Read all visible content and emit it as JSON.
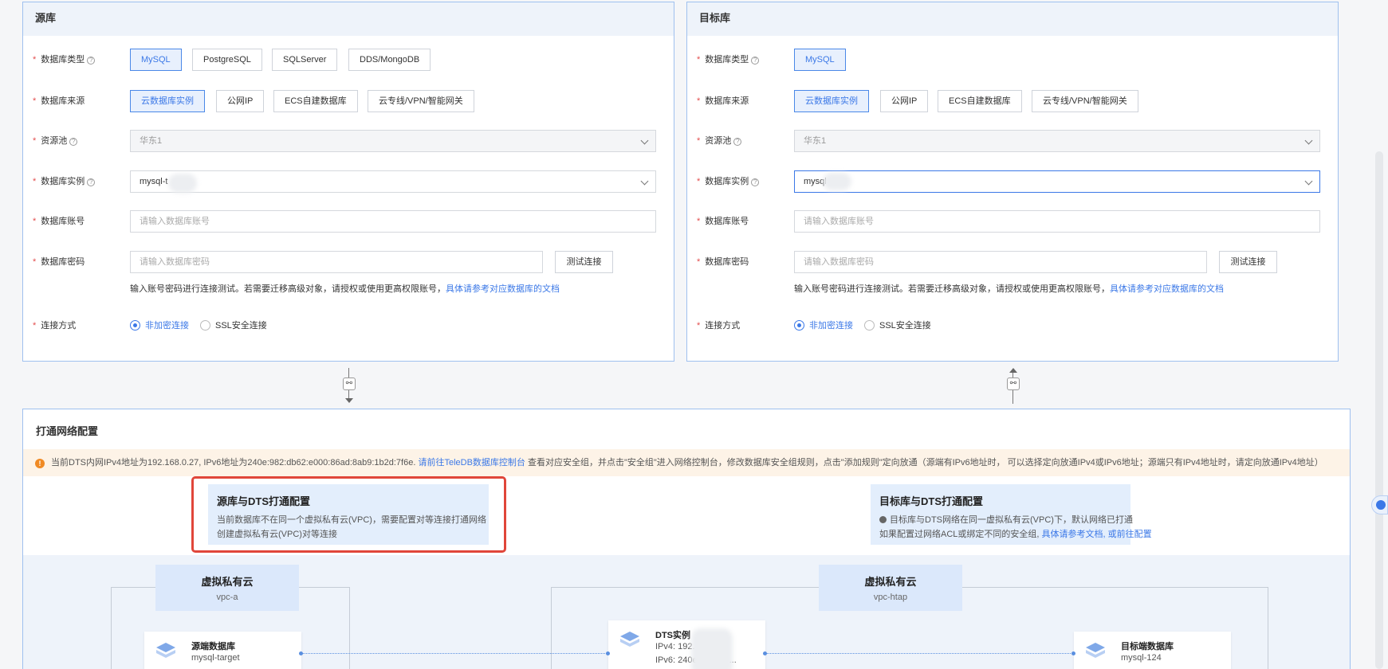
{
  "source": {
    "header": "源库",
    "db_type": {
      "label": "数据库类型",
      "options": [
        "MySQL",
        "PostgreSQL",
        "SQLServer",
        "DDS/MongoDB"
      ],
      "selected": "MySQL"
    },
    "db_source": {
      "label": "数据库来源",
      "options": [
        "云数据库实例",
        "公网IP",
        "ECS自建数据库",
        "云专线/VPN/智能网关"
      ],
      "selected": "云数据库实例"
    },
    "resource_pool": {
      "label": "资源池",
      "value": "华东1"
    },
    "instance": {
      "label": "数据库实例",
      "value": "mysql-t"
    },
    "account": {
      "label": "数据库账号",
      "placeholder": "请输入数据库账号"
    },
    "password": {
      "label": "数据库密码",
      "placeholder": "请输入数据库密码",
      "test_button": "测试连接"
    },
    "hint": {
      "text": "输入账号密码进行连接测试。若需要迁移高级对象，请授权或使用更高权限账号，",
      "link": "具体请参考对应数据库的文档"
    },
    "connection": {
      "label": "连接方式",
      "options": [
        "非加密连接",
        "SSL安全连接"
      ],
      "selected": "非加密连接"
    }
  },
  "target": {
    "header": "目标库",
    "db_type": {
      "label": "数据库类型",
      "options": [
        "MySQL"
      ],
      "selected": "MySQL"
    },
    "db_source": {
      "label": "数据库来源",
      "options": [
        "云数据库实例",
        "公网IP",
        "ECS自建数据库",
        "云专线/VPN/智能网关"
      ],
      "selected": "云数据库实例"
    },
    "resource_pool": {
      "label": "资源池",
      "value": "华东1"
    },
    "instance": {
      "label": "数据库实例",
      "value": "mysql"
    },
    "account": {
      "label": "数据库账号",
      "placeholder": "请输入数据库账号"
    },
    "password": {
      "label": "数据库密码",
      "placeholder": "请输入数据库密码",
      "test_button": "测试连接"
    },
    "hint": {
      "text": "输入账号密码进行连接测试。若需要迁移高级对象，请授权或使用更高权限账号，",
      "link": "具体请参考对应数据库的文档"
    },
    "connection": {
      "label": "连接方式",
      "options": [
        "非加密连接",
        "SSL安全连接"
      ],
      "selected": "非加密连接"
    }
  },
  "network": {
    "title": "打通网络配置",
    "notice": {
      "prefix": "当前DTS内网IPv4地址为192.168.0.27, IPv6地址为240e:982:db62:e000:86ad:8ab9:1b2d:7f6e.",
      "link": "请前往TeleDB数据库控制台",
      "suffix": "查看对应安全组，并点击\"安全组\"进入网络控制台，修改数据库安全组规则，点击\"添加规则\"定向放通（源端有IPv6地址时， 可以选择定向放通IPv4或IPv6地址；源端只有IPv4地址时，请定向放通IPv4地址）"
    },
    "source_cfg": {
      "title": "源库与DTS打通配置",
      "text": "当前数据库不在同一个虚拟私有云(VPC)，需要配置对等连接打通网络",
      "link": "创建虚拟私有云(VPC)对等连接"
    },
    "target_cfg": {
      "title": "目标库与DTS打通配置",
      "text": "目标库与DTS网络在同一虚拟私有云(VPC)下，默认网络已打通",
      "text2": "如果配置过网络ACL或绑定不同的安全组,",
      "link1": "具体请参考文档,",
      "link2": "或前往配置"
    },
    "vpc_left": {
      "name": "虚拟私有云",
      "id": "vpc-a"
    },
    "vpc_right": {
      "name": "虚拟私有云",
      "id": "vpc-htap"
    },
    "source_node": {
      "title": "源端数据库",
      "sub": "mysql-target"
    },
    "dts_node": {
      "title": "DTS实例",
      "ipv4": "IPv4: 192.",
      "ipv6": "IPv6: 240e",
      "ellipsis": "..."
    },
    "target_node": {
      "title": "目标端数据库",
      "sub": "mysql-124"
    }
  },
  "icons": [
    "help-icon",
    "chevron-down-icon",
    "link-icon",
    "warning-icon",
    "database-icon"
  ],
  "colors": {
    "accent": "#3b78e7",
    "warning": "#f08a24",
    "highlight": "#e0463a"
  }
}
